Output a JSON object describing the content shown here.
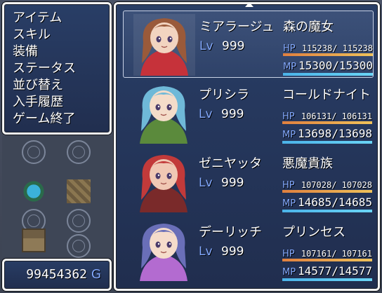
{
  "menu": {
    "items": [
      "アイテム",
      "スキル",
      "装備",
      "ステータス",
      "並び替え",
      "入手履歴",
      "ゲーム終了"
    ],
    "selected_index": 3
  },
  "gold": {
    "value": "99454362",
    "unit": "G"
  },
  "labels": {
    "level": "Lv",
    "hp": "HP",
    "mp": "MP"
  },
  "actors": [
    {
      "name": "ミアラージュ",
      "class": "森の魔女",
      "level": "999",
      "hp": "115238/ 115238",
      "mp": "15300/15300",
      "hp_rate": 1.0,
      "mp_rate": 1.0,
      "hair": "#9a5a3a",
      "outfit": "#c6323a",
      "skin": "#f2d4c0",
      "selected": true
    },
    {
      "name": "プリシラ",
      "class": "コールドナイト",
      "level": "999",
      "hp": "106131/ 106131",
      "mp": "13698/13698",
      "hp_rate": 1.0,
      "mp_rate": 1.0,
      "hair": "#6fb9d8",
      "outfit": "#5b8a3c",
      "skin": "#f4dcc9",
      "selected": false
    },
    {
      "name": "ゼニヤッタ",
      "class": "悪魔貴族",
      "level": "999",
      "hp": "107028/ 107028",
      "mp": "14685/14685",
      "hp_rate": 1.0,
      "mp_rate": 1.0,
      "hair": "#c23a3a",
      "outfit": "#7a2a2a",
      "skin": "#f0c8b4",
      "selected": false
    },
    {
      "name": "デーリッチ",
      "class": "プリンセス",
      "level": "999",
      "hp": "107161/ 107161",
      "mp": "14577/14577",
      "hp_rate": 1.0,
      "mp_rate": 1.0,
      "hair": "#6a6fb8",
      "outfit": "#b36bd0",
      "skin": "#f5dccb",
      "selected": false
    }
  ],
  "colors": {
    "window": "#263c66",
    "system_blue": "#84aaff",
    "hp_gauge": "#efa24a",
    "mp_gauge": "#4bb3e8"
  }
}
